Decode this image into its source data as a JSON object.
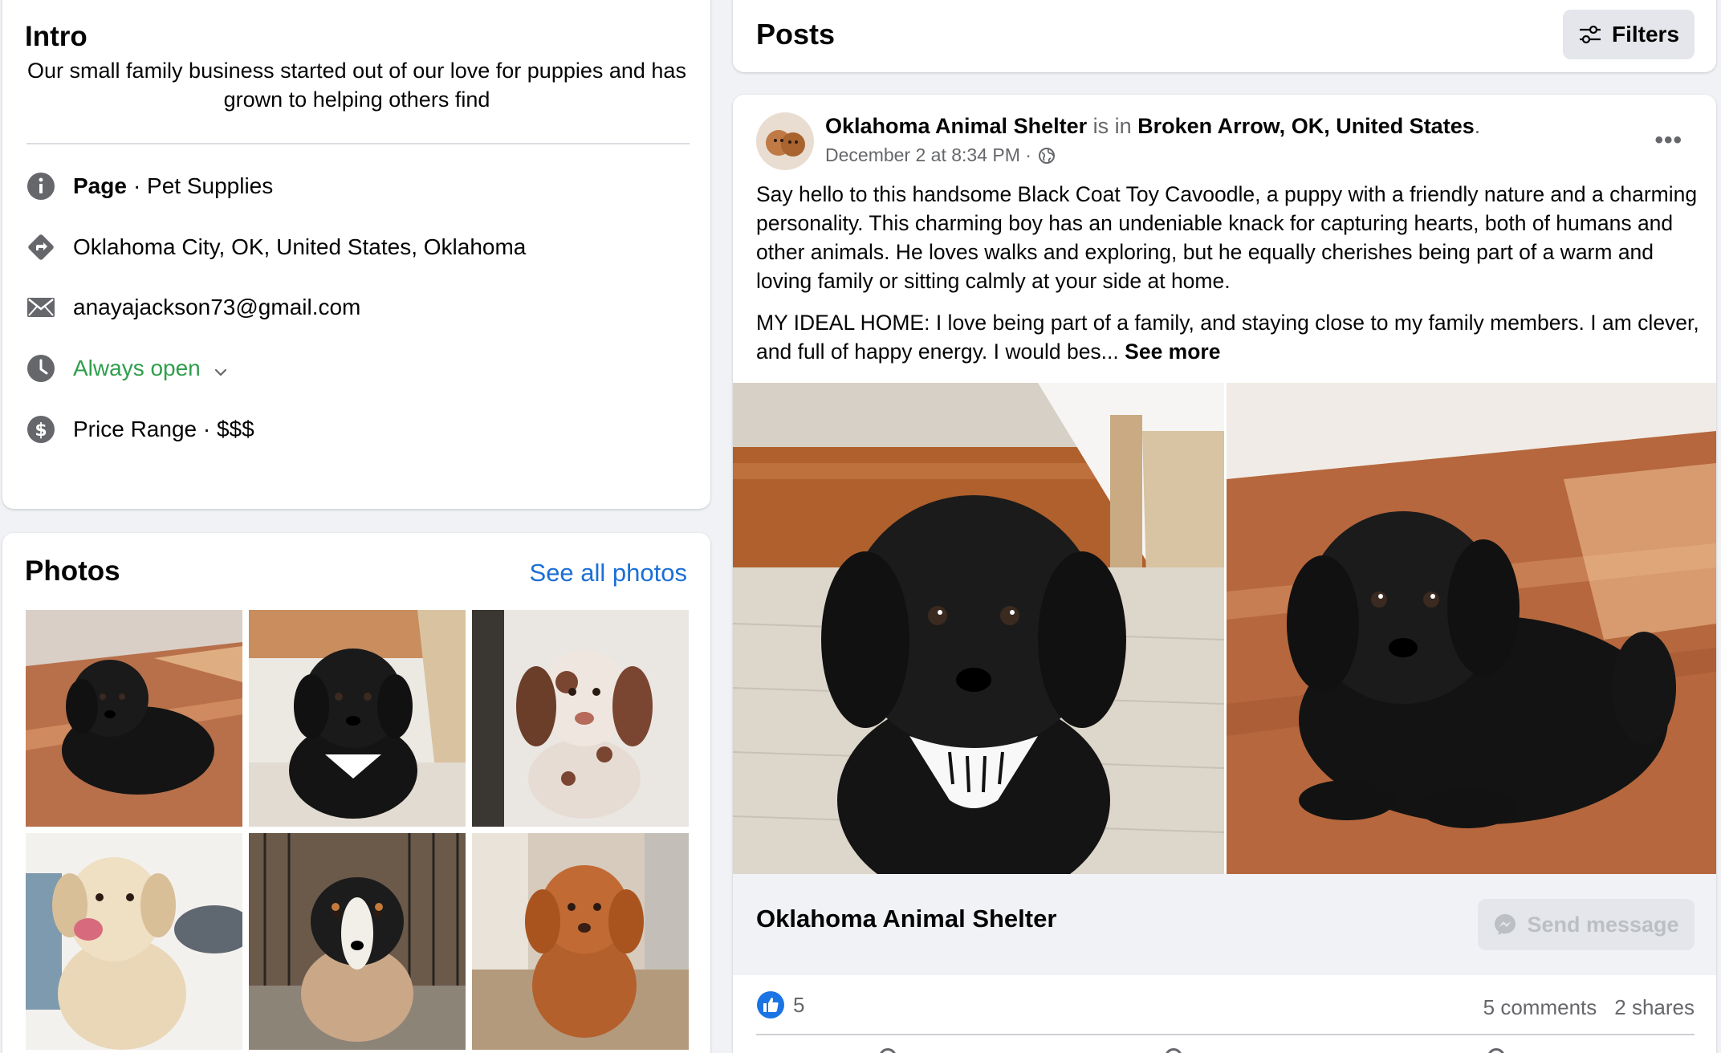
{
  "intro": {
    "title": "Intro",
    "bio": "Our small family business started out of our love for puppies and has grown to helping others find",
    "category_label": "Page",
    "category_value": "· Pet Supplies",
    "address": "Oklahoma City, OK, United States, Oklahoma",
    "email": "anayajackson73@gmail.com",
    "hours": "Always open",
    "price_range": "Price Range · $$$",
    "icons": [
      "info-icon",
      "directions-icon",
      "mail-icon",
      "clock-icon",
      "dollar-icon"
    ]
  },
  "photos": {
    "title": "Photos",
    "see_all": "See all photos",
    "thumbnails": [
      "black-puppy-lying-on-floor",
      "black-puppy-with-bandana",
      "dapple-dachshund-puppy",
      "yellow-lab-puppy-tongue-out",
      "tricolor-aussie-puppy",
      "red-cavoodle-puppy"
    ]
  },
  "posts": {
    "title": "Posts",
    "filters_label": "Filters"
  },
  "post": {
    "author": "Oklahoma Animal Shelter",
    "is_in": "is in",
    "location": "Broken Arrow, OK, United States",
    "period": ".",
    "date": "December 2 at 8:34 PM ·",
    "more": "•••",
    "paragraph_1": "Say hello to this handsome Black Coat Toy Cavoodle, a puppy with a friendly nature and a charming personality. This charming boy has an undeniable knack for capturing hearts, both of humans and other animals. He loves walks and exploring, but he equally cherishes being part of a warm and loving family or sitting calmly at your side at home.",
    "paragraph_2": "MY IDEAL HOME: I love being part of a family, and staying close to my family members. I am clever, and full of happy energy. I would bes...",
    "see_more": "See more",
    "share_name": "Oklahoma Animal Shelter",
    "send_message": "Send message",
    "likes": "5",
    "comments": "5 comments",
    "shares": "2 shares"
  },
  "colors": {
    "background": "#f0f2f5",
    "link_blue": "#1b6fd6",
    "open_green": "#2e9e4b",
    "muted": "#65676b"
  }
}
